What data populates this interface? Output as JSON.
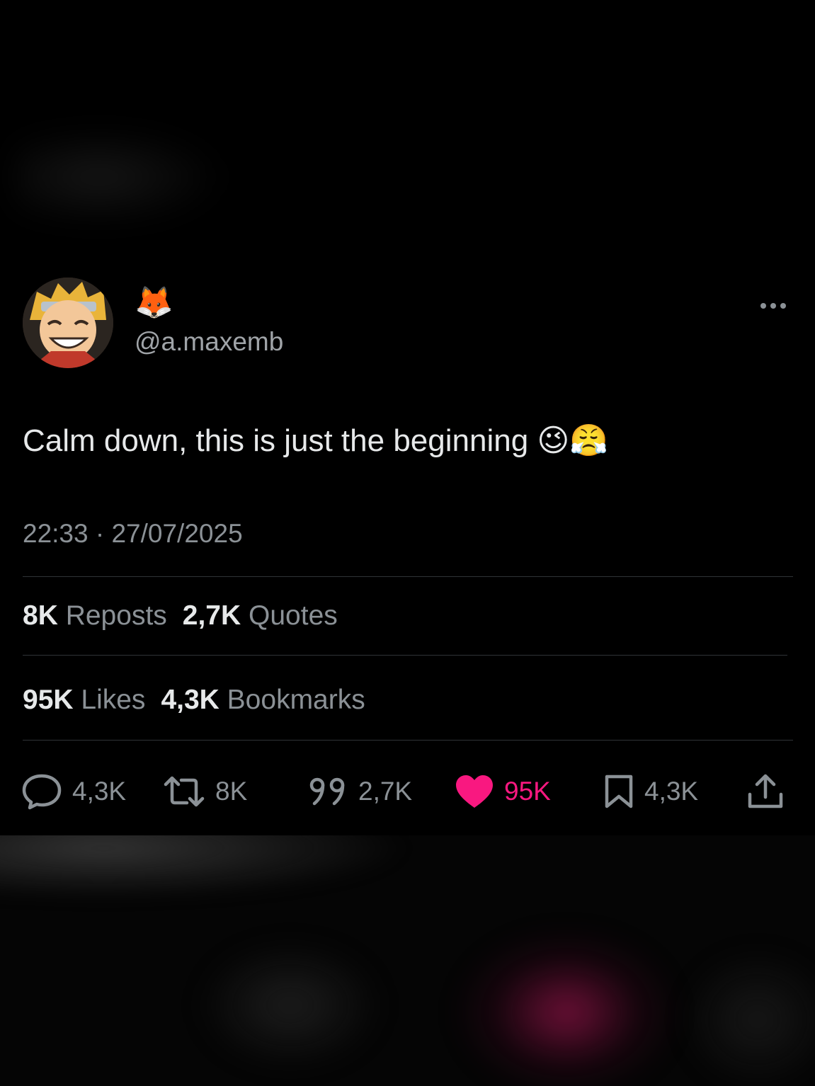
{
  "user": {
    "display_name": "🦊",
    "handle": "@a.maxemb"
  },
  "tweet": {
    "text": "Calm down, this is just the beginning 😉😤",
    "timestamp": "22:33 · 27/07/2025"
  },
  "stats": {
    "reposts_count": "8K",
    "reposts_label": "Reposts",
    "quotes_count": "2,7K",
    "quotes_label": "Quotes",
    "likes_count": "95K",
    "likes_label": "Likes",
    "bookmarks_count": "4,3K",
    "bookmarks_label": "Bookmarks"
  },
  "actions": [
    {
      "icon": "reply-icon",
      "count": "4,3K"
    },
    {
      "icon": "repost-icon",
      "count": "8K"
    },
    {
      "icon": "quote-icon",
      "count": "2,7K"
    },
    {
      "icon": "heart-icon",
      "count": "95K",
      "active": true,
      "color": "#f91880"
    },
    {
      "icon": "bookmark-icon",
      "count": "4,3K"
    },
    {
      "icon": "share-icon"
    }
  ],
  "colors": {
    "background": "#000000",
    "text_primary": "#e7e9ea",
    "text_secondary": "#8b9196",
    "like_pink": "#f91880",
    "divider": "#2f3336"
  }
}
